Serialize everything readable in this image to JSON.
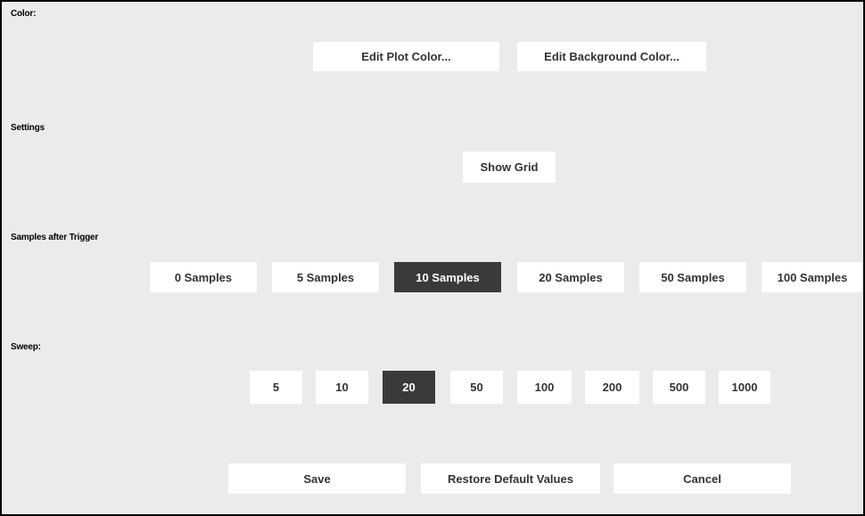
{
  "color": {
    "label": "Color:",
    "edit_plot_color": "Edit Plot Color...",
    "edit_background_color": "Edit Background Color..."
  },
  "settings": {
    "label": "Settings",
    "show_grid": "Show Grid"
  },
  "samples_after_trigger": {
    "label": "Samples after Trigger",
    "options": [
      "0 Samples",
      "5 Samples",
      "10 Samples",
      "20 Samples",
      "50 Samples",
      "100 Samples"
    ],
    "selected": "10 Samples"
  },
  "sweep": {
    "label": "Sweep:",
    "options": [
      "5",
      "10",
      "20",
      "50",
      "100",
      "200",
      "500",
      "1000"
    ],
    "selected": "20"
  },
  "footer": {
    "save": "Save",
    "restore": "Restore Default Values",
    "cancel": "Cancel"
  },
  "colors": {
    "panel_background": "#ebebeb",
    "button_background": "#ffffff",
    "selected_background": "#3a3a3a",
    "selected_text": "#ffffff"
  }
}
